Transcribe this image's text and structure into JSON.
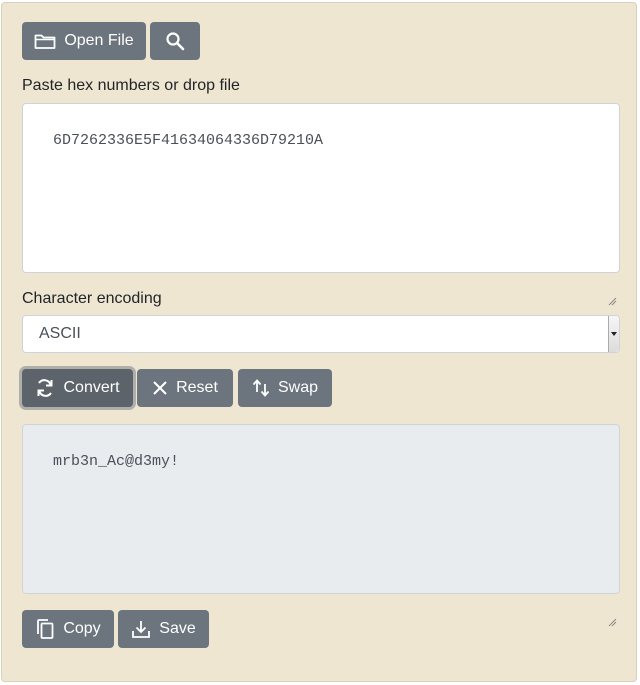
{
  "toolbar": {
    "open_file_label": "Open File",
    "open_file_icon": "folder-icon",
    "search_icon": "search-icon"
  },
  "input": {
    "label": "Paste hex numbers or drop file",
    "value": "6D7262336E5F41634064336D79210A"
  },
  "encoding": {
    "label": "Character encoding",
    "selected": "ASCII"
  },
  "actions": {
    "convert_label": "Convert",
    "convert_icon": "refresh-icon",
    "reset_label": "Reset",
    "reset_icon": "close-icon",
    "swap_label": "Swap",
    "swap_icon": "swap-icon"
  },
  "output": {
    "value": "mrb3n_Ac@d3my!"
  },
  "footer": {
    "copy_label": "Copy",
    "copy_icon": "copy-icon",
    "save_label": "Save",
    "save_icon": "download-icon"
  },
  "colors": {
    "panel_bg": "#efe6d2",
    "button_bg": "#6c757d",
    "output_bg": "#e9ecef"
  }
}
